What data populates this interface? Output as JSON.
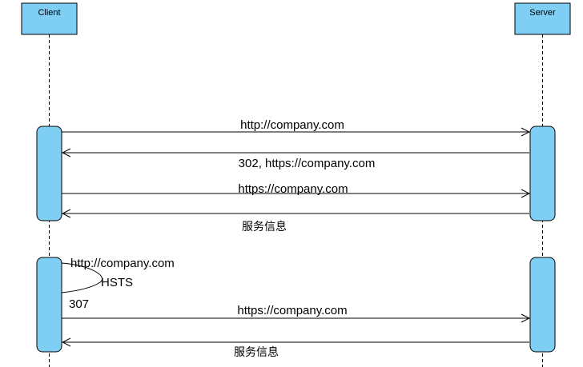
{
  "participants": {
    "client": "Client",
    "server": "Server"
  },
  "messages": {
    "m1_request": "http://company.com",
    "m2_redirect": "302, https://company.com",
    "m3_request_https": "https://company.com",
    "m4_response": "服务信息",
    "m5_self_request": "http://company.com",
    "m5_hsts": "HSTS",
    "m5_status": "307",
    "m6_request_https": "https://company.com",
    "m7_response": "服务信息"
  },
  "colors": {
    "box_fill": "#7fcff5",
    "stroke": "#000000"
  }
}
